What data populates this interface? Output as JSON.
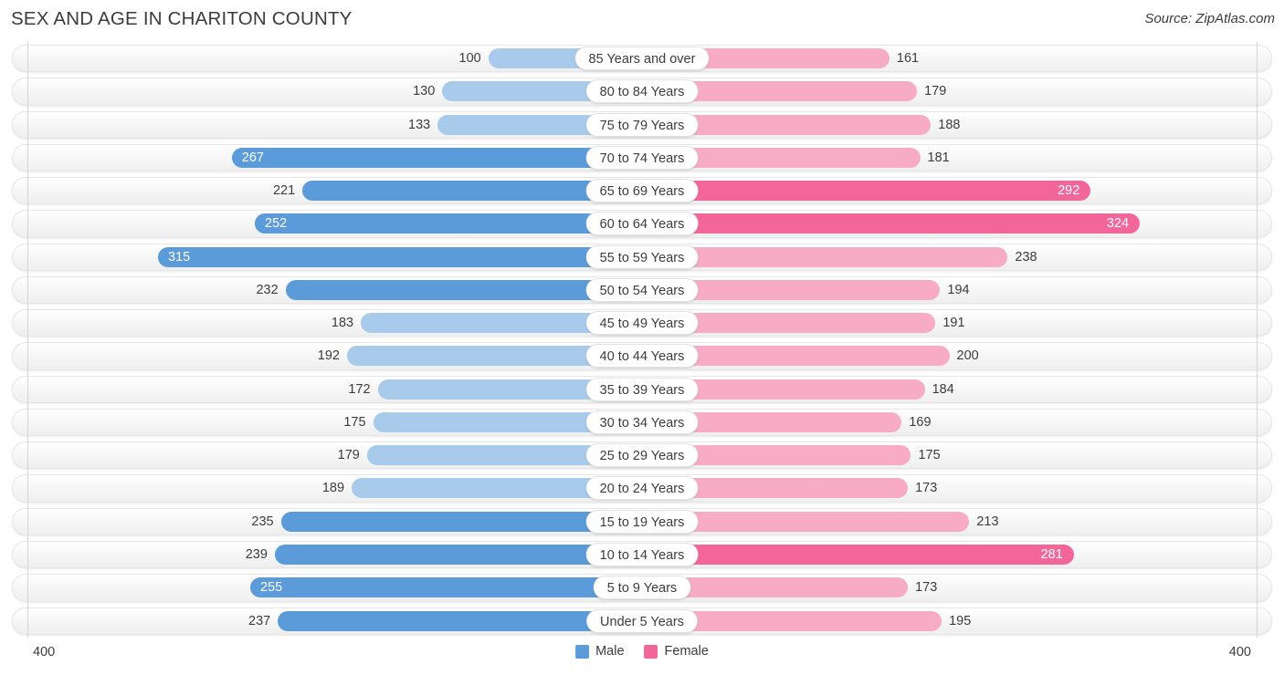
{
  "header": {
    "title": "SEX AND AGE IN CHARITON COUNTY",
    "source": "Source: ZipAtlas.com"
  },
  "legend": {
    "male_label": "Male",
    "female_label": "Female",
    "male_color": "#5c9bd9",
    "female_color": "#f2669a"
  },
  "axis": {
    "left_max": "400",
    "right_max": "400",
    "max_value": 400
  },
  "chart_data": {
    "type": "bar",
    "title": "SEX AND AGE IN CHARITON COUNTY",
    "subtitle": "Source: ZipAtlas.com",
    "orientation": "horizontal-diverging",
    "xlabel": "",
    "ylabel": "",
    "xlim": [
      0,
      400
    ],
    "grid": false,
    "legend_position": "bottom-center",
    "categories": [
      "85 Years and over",
      "80 to 84 Years",
      "75 to 79 Years",
      "70 to 74 Years",
      "65 to 69 Years",
      "60 to 64 Years",
      "55 to 59 Years",
      "50 to 54 Years",
      "45 to 49 Years",
      "40 to 44 Years",
      "35 to 39 Years",
      "30 to 34 Years",
      "25 to 29 Years",
      "20 to 24 Years",
      "15 to 19 Years",
      "10 to 14 Years",
      "5 to 9 Years",
      "Under 5 Years"
    ],
    "series": [
      {
        "name": "Male",
        "color": "#5c9bd9",
        "values": [
          100,
          130,
          133,
          267,
          221,
          252,
          315,
          232,
          183,
          192,
          172,
          175,
          179,
          189,
          235,
          239,
          255,
          237
        ]
      },
      {
        "name": "Female",
        "color": "#f2669a",
        "values": [
          161,
          179,
          188,
          181,
          292,
          324,
          238,
          194,
          191,
          200,
          184,
          169,
          175,
          173,
          213,
          281,
          173,
          195
        ]
      }
    ]
  },
  "rows": [
    {
      "age": "85 Years and over",
      "male": 100,
      "female": 161,
      "male_label": "100",
      "female_label": "161",
      "male_inside": false,
      "female_inside": false,
      "male_hi": false,
      "female_hi": false
    },
    {
      "age": "80 to 84 Years",
      "male": 130,
      "female": 179,
      "male_label": "130",
      "female_label": "179",
      "male_inside": false,
      "female_inside": false,
      "male_hi": false,
      "female_hi": false
    },
    {
      "age": "75 to 79 Years",
      "male": 133,
      "female": 188,
      "male_label": "133",
      "female_label": "188",
      "male_inside": false,
      "female_inside": false,
      "male_hi": false,
      "female_hi": false
    },
    {
      "age": "70 to 74 Years",
      "male": 267,
      "female": 181,
      "male_label": "267",
      "female_label": "181",
      "male_inside": true,
      "female_inside": false,
      "male_hi": true,
      "female_hi": false
    },
    {
      "age": "65 to 69 Years",
      "male": 221,
      "female": 292,
      "male_label": "221",
      "female_label": "292",
      "male_inside": false,
      "female_inside": true,
      "male_hi": true,
      "female_hi": true
    },
    {
      "age": "60 to 64 Years",
      "male": 252,
      "female": 324,
      "male_label": "252",
      "female_label": "324",
      "male_inside": true,
      "female_inside": true,
      "male_hi": true,
      "female_hi": true
    },
    {
      "age": "55 to 59 Years",
      "male": 315,
      "female": 238,
      "male_label": "315",
      "female_label": "238",
      "male_inside": true,
      "female_inside": false,
      "male_hi": true,
      "female_hi": false
    },
    {
      "age": "50 to 54 Years",
      "male": 232,
      "female": 194,
      "male_label": "232",
      "female_label": "194",
      "male_inside": false,
      "female_inside": false,
      "male_hi": true,
      "female_hi": false
    },
    {
      "age": "45 to 49 Years",
      "male": 183,
      "female": 191,
      "male_label": "183",
      "female_label": "191",
      "male_inside": false,
      "female_inside": false,
      "male_hi": false,
      "female_hi": false
    },
    {
      "age": "40 to 44 Years",
      "male": 192,
      "female": 200,
      "male_label": "192",
      "female_label": "200",
      "male_inside": false,
      "female_inside": false,
      "male_hi": false,
      "female_hi": false
    },
    {
      "age": "35 to 39 Years",
      "male": 172,
      "female": 184,
      "male_label": "172",
      "female_label": "184",
      "male_inside": false,
      "female_inside": false,
      "male_hi": false,
      "female_hi": false
    },
    {
      "age": "30 to 34 Years",
      "male": 175,
      "female": 169,
      "male_label": "175",
      "female_label": "169",
      "male_inside": false,
      "female_inside": false,
      "male_hi": false,
      "female_hi": false
    },
    {
      "age": "25 to 29 Years",
      "male": 179,
      "female": 175,
      "male_label": "179",
      "female_label": "175",
      "male_inside": false,
      "female_inside": false,
      "male_hi": false,
      "female_hi": false
    },
    {
      "age": "20 to 24 Years",
      "male": 189,
      "female": 173,
      "male_label": "189",
      "female_label": "173",
      "male_inside": false,
      "female_inside": false,
      "male_hi": false,
      "female_hi": false
    },
    {
      "age": "15 to 19 Years",
      "male": 235,
      "female": 213,
      "male_label": "235",
      "female_label": "213",
      "male_inside": false,
      "female_inside": false,
      "male_hi": true,
      "female_hi": false
    },
    {
      "age": "10 to 14 Years",
      "male": 239,
      "female": 281,
      "male_label": "239",
      "female_label": "281",
      "male_inside": false,
      "female_inside": true,
      "male_hi": true,
      "female_hi": true
    },
    {
      "age": "5 to 9 Years",
      "male": 255,
      "female": 173,
      "male_label": "255",
      "female_label": "173",
      "male_inside": true,
      "female_inside": false,
      "male_hi": true,
      "female_hi": false
    },
    {
      "age": "Under 5 Years",
      "male": 237,
      "female": 195,
      "male_label": "237",
      "female_label": "195",
      "male_inside": false,
      "female_inside": false,
      "male_hi": true,
      "female_hi": false
    }
  ]
}
